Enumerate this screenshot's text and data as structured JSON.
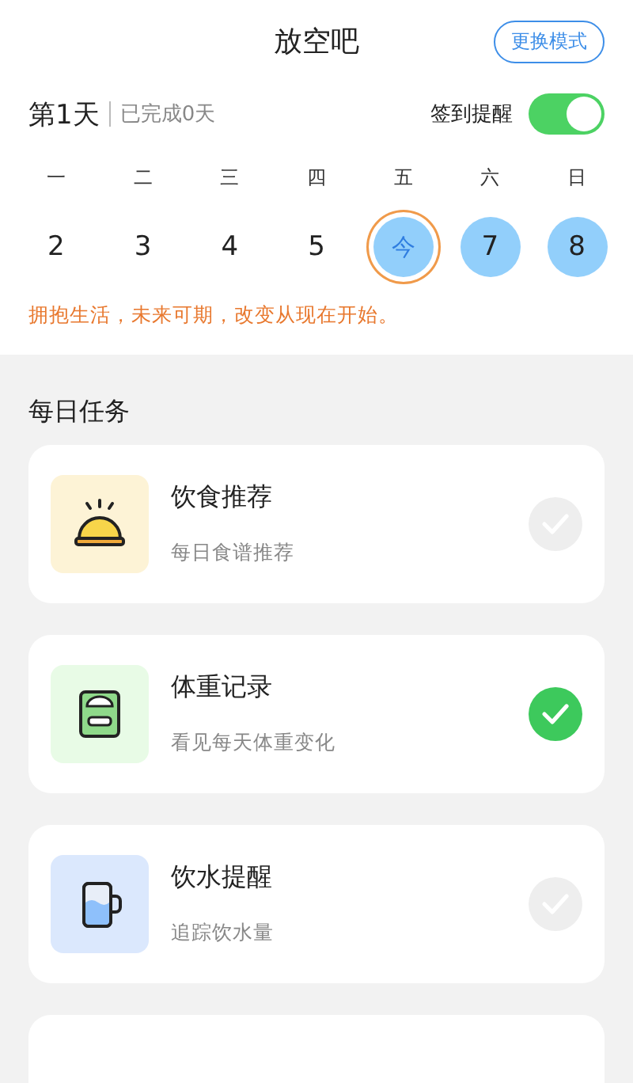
{
  "header": {
    "title": "放空吧",
    "mode_button": "更换模式"
  },
  "progress": {
    "day": "第1天",
    "completed": "已完成0天",
    "reminder_label": "签到提醒",
    "reminder_on": true
  },
  "week": {
    "weekdays": [
      "一",
      "二",
      "三",
      "四",
      "五",
      "六",
      "日"
    ],
    "days": [
      {
        "label": "2",
        "kind": "past"
      },
      {
        "label": "3",
        "kind": "past"
      },
      {
        "label": "4",
        "kind": "past"
      },
      {
        "label": "5",
        "kind": "past"
      },
      {
        "label": "今",
        "kind": "today"
      },
      {
        "label": "7",
        "kind": "future"
      },
      {
        "label": "8",
        "kind": "future"
      }
    ]
  },
  "motto": "拥抱生活，未来可期，改变从现在开始。",
  "section_title": "每日任务",
  "tasks": [
    {
      "kind": "food",
      "title": "饮食推荐",
      "subtitle": "每日食谱推荐",
      "done": false
    },
    {
      "kind": "weight",
      "title": "体重记录",
      "subtitle": "看见每天体重变化",
      "done": true
    },
    {
      "kind": "water",
      "title": "饮水提醒",
      "subtitle": "追踪饮水量",
      "done": false
    }
  ]
}
